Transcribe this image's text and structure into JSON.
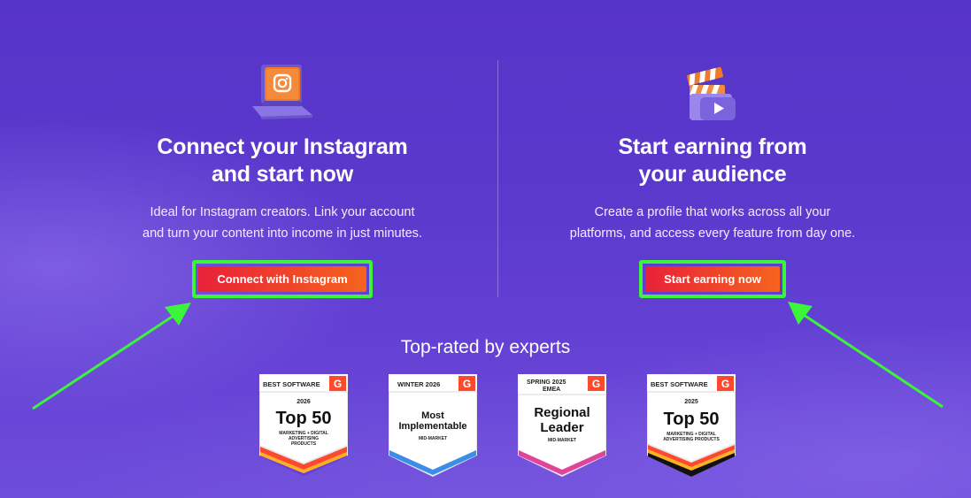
{
  "left_panel": {
    "icon": "instagram-laptop-icon",
    "title_line1": "Connect your Instagram",
    "title_line2": "and start now",
    "desc_line1": "Ideal for Instagram creators. Link your account",
    "desc_line2": "and turn your content into income in just minutes.",
    "button_label": "Connect with Instagram"
  },
  "right_panel": {
    "icon": "clapperboard-play-icon",
    "title_line1": "Start earning from",
    "title_line2": "your audience",
    "desc_line1": "Create a profile that works across all your",
    "desc_line2": "platforms, and access every feature from day one.",
    "button_label": "Start earning now"
  },
  "rated_heading": "Top-rated by experts",
  "badges": [
    {
      "top_label": "BEST SOFTWARE",
      "year": "2026",
      "title": "Top 50",
      "subtitle_line1": "MARKETING + DIGITAL",
      "subtitle_line2": "ADVERTISING",
      "subtitle_line3": "PRODUCTS"
    },
    {
      "top_label": "WINTER 2026",
      "title_line1": "Most",
      "title_line2": "Implementable",
      "subtitle": "MID-MARKET"
    },
    {
      "top_label_line1": "SPRING 2025",
      "top_label_line2": "EMEA",
      "title_line1": "Regional",
      "title_line2": "Leader",
      "subtitle": "MID-MARKET"
    },
    {
      "top_label": "BEST SOFTWARE",
      "year": "2025",
      "title": "Top 50",
      "subtitle_line1": "MARKETING + DIGITAL",
      "subtitle_line2": "ADVERTISING PRODUCTS"
    }
  ],
  "g2_mark": "G",
  "colors": {
    "background": "#5b39cd",
    "button_gradient_start": "#e8213a",
    "button_gradient_end": "#f5641f",
    "highlight": "#3cf53a"
  }
}
